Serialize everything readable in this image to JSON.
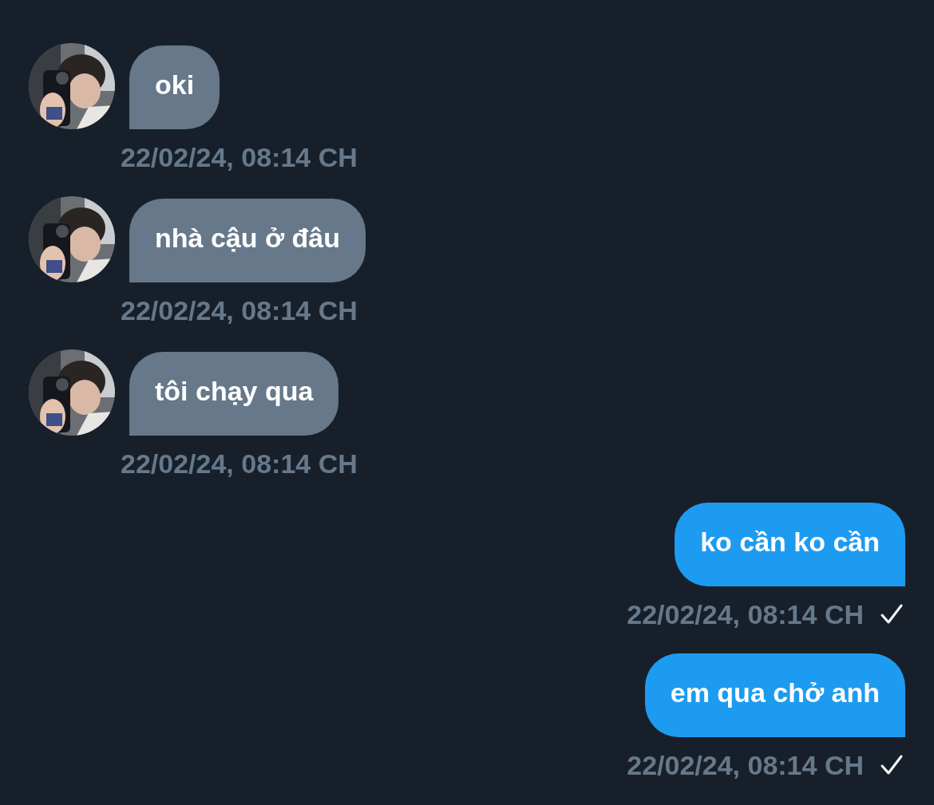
{
  "messages": [
    {
      "kind": "received",
      "text": "oki",
      "time": "22/02/24, 08:14 CH"
    },
    {
      "kind": "received",
      "text": "nhà cậu ở đâu",
      "time": "22/02/24, 08:14 CH"
    },
    {
      "kind": "received",
      "text": "tôi chạy qua",
      "time": "22/02/24, 08:14 CH"
    },
    {
      "kind": "sent",
      "text": "ko cần ko cần",
      "time": "22/02/24, 08:14 CH"
    },
    {
      "kind": "sent",
      "text": "em qua chở anh",
      "time": "22/02/24, 08:14 CH"
    }
  ]
}
